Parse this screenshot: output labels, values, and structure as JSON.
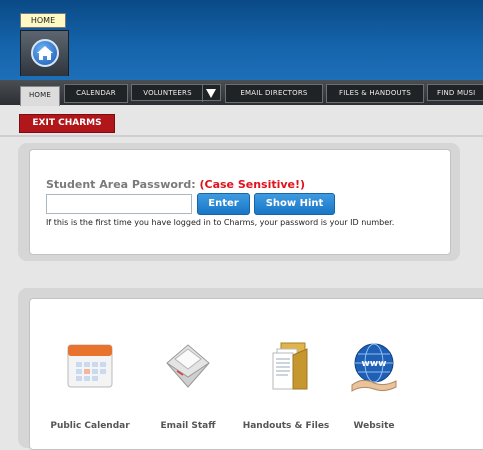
{
  "header": {
    "home_tooltip": "HOME"
  },
  "nav": {
    "tabs": [
      {
        "label": "HOME"
      },
      {
        "label": "CALENDAR"
      },
      {
        "label": "VOLUNTEERS"
      },
      {
        "label": "EMAIL DIRECTORS"
      },
      {
        "label": "FILES & HANDOUTS"
      },
      {
        "label": "FIND MUSI"
      }
    ]
  },
  "exit_button": "EXIT CHARMS",
  "password": {
    "label": "Student Area Password:",
    "note": "(Case Sensitive!)",
    "input_value": "",
    "enter_label": "Enter",
    "hint_label": "Show Hint",
    "help_text": "If this is the first time you have logged in to Charms, your password is your ID number."
  },
  "quicklinks": [
    {
      "label": "Public Calendar",
      "icon": "calendar-icon"
    },
    {
      "label": "Email Staff",
      "icon": "envelope-icon"
    },
    {
      "label": "Handouts & Files",
      "icon": "folder-icon"
    },
    {
      "label": "Website",
      "icon": "globe-icon"
    }
  ],
  "colors": {
    "header_blue": "#1463aa",
    "exit_red": "#b1161a",
    "button_blue": "#1976c6",
    "case_note_red": "#e0121b"
  }
}
